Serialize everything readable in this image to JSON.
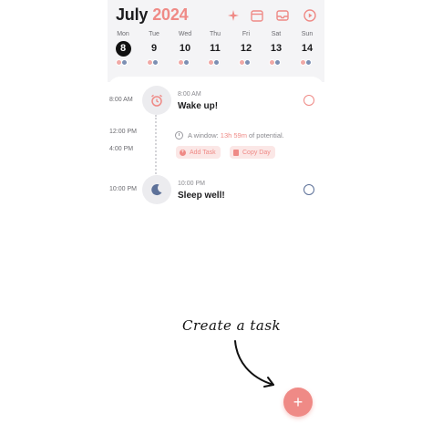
{
  "header": {
    "month": "July",
    "year": "2024"
  },
  "days": [
    {
      "name": "Mon",
      "num": "8",
      "selected": true
    },
    {
      "name": "Tue",
      "num": "9"
    },
    {
      "name": "Wed",
      "num": "10"
    },
    {
      "name": "Thu",
      "num": "11"
    },
    {
      "name": "Fri",
      "num": "12"
    },
    {
      "name": "Sat",
      "num": "13"
    },
    {
      "name": "Sun",
      "num": "14"
    }
  ],
  "timeline": {
    "wake": {
      "time": "8:00 AM",
      "small_time": "8:00 AM",
      "title": "Wake up!"
    },
    "times": {
      "t1": "12:00 PM",
      "t2": "4:00 PM"
    },
    "window": {
      "prefix": "A window:",
      "duration": "13h 59m",
      "suffix": "of potential."
    },
    "add_task": "Add Task",
    "copy_day": "Copy Day",
    "sleep": {
      "time": "10:00 PM",
      "small_time": "10:00 PM",
      "title": "Sleep well!"
    }
  },
  "annotation": "Create a task",
  "fab_label": "+",
  "colors": {
    "accent": "#ef8a86",
    "night": "#5d7199",
    "header_bg": "#f4f4f6"
  },
  "icons": [
    "sparkle-icon",
    "calendar-icon",
    "inbox-icon",
    "play-circle-icon",
    "alarm-icon",
    "moon-icon",
    "clock-icon"
  ]
}
